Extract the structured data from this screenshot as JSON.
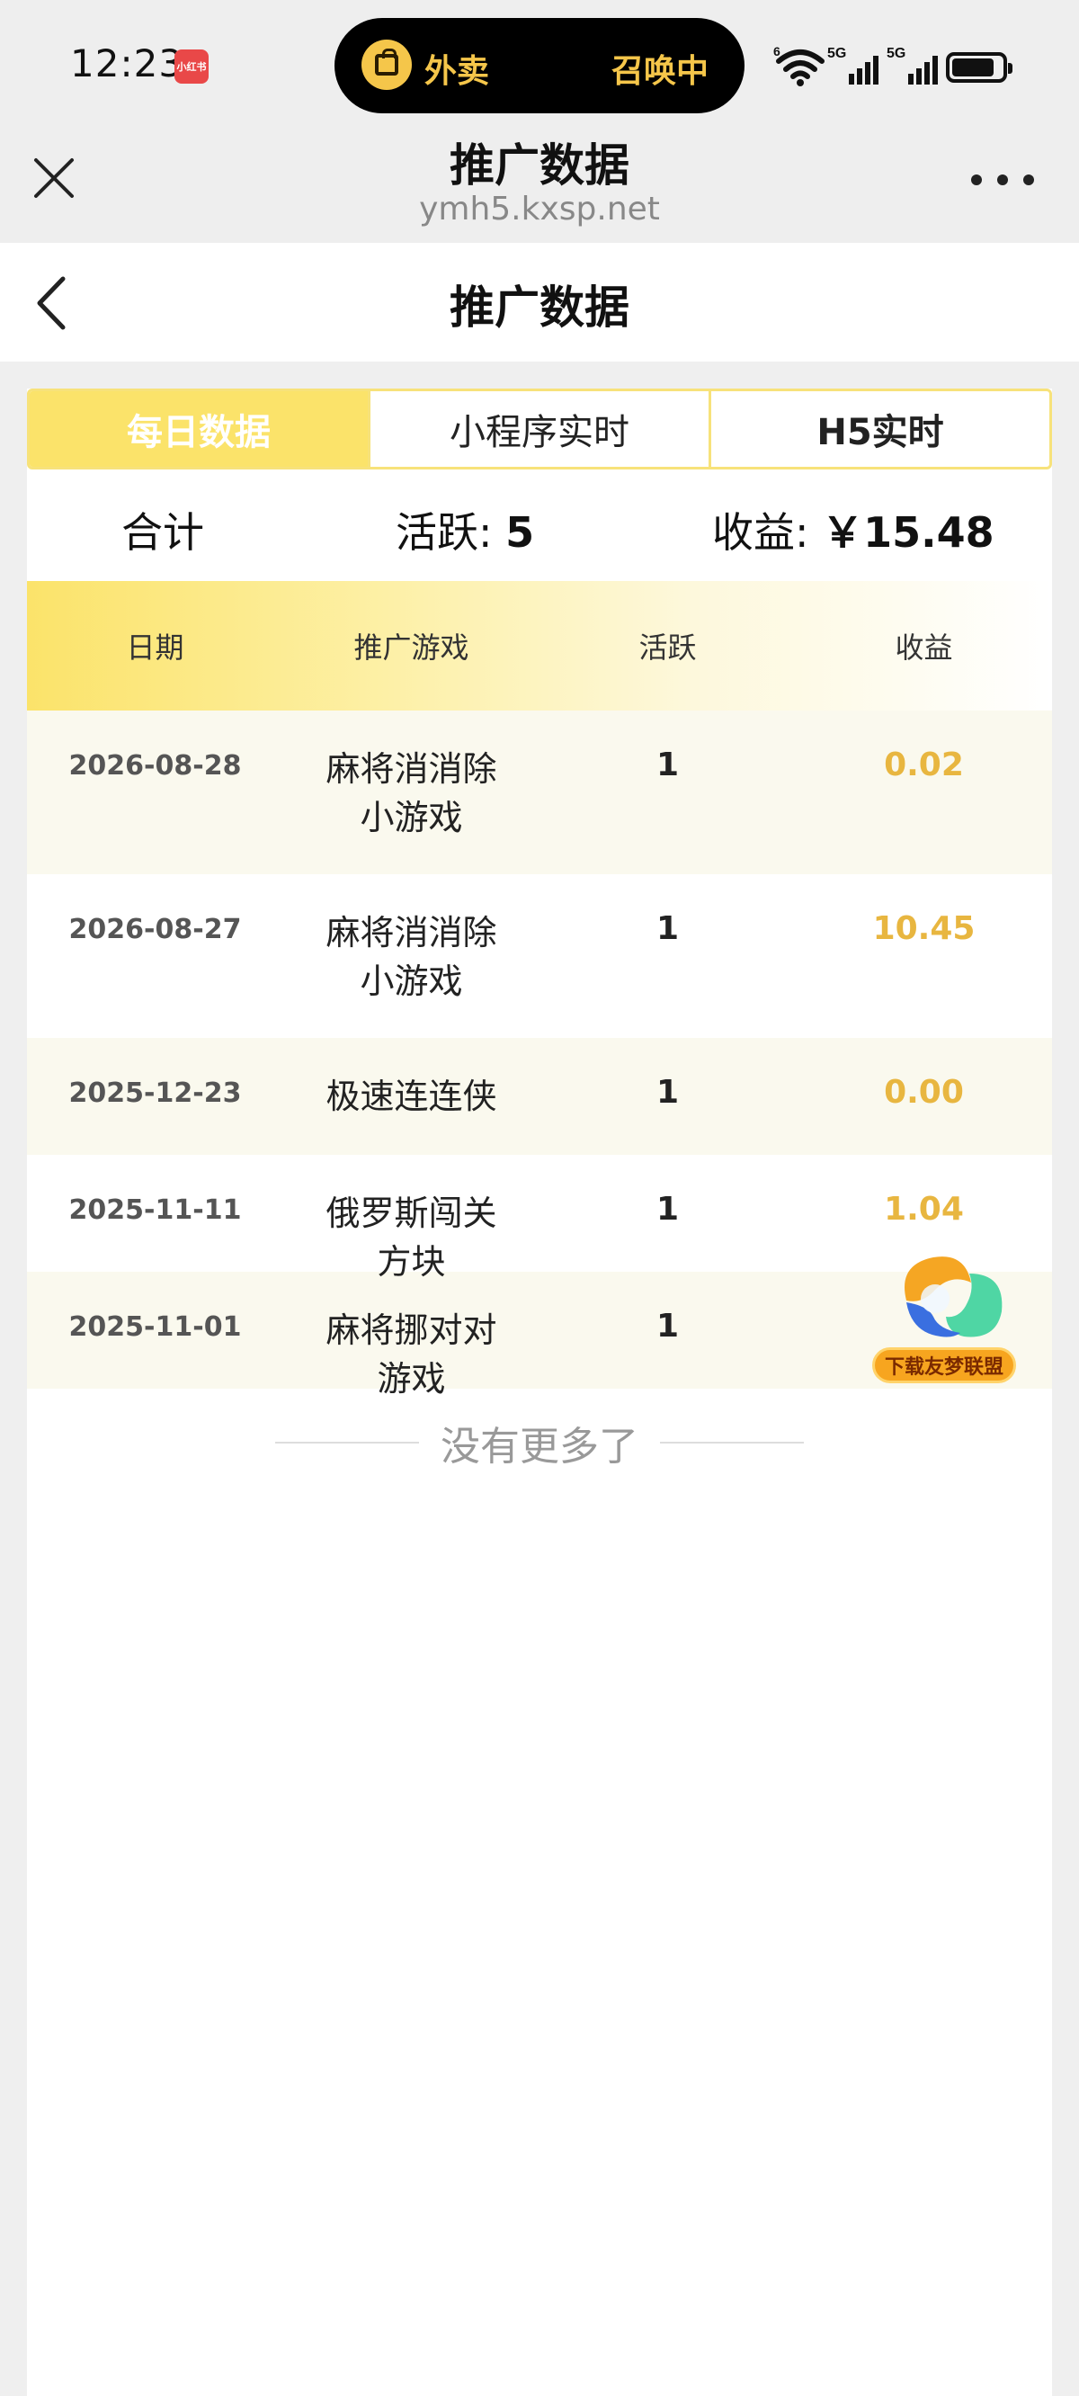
{
  "status_bar": {
    "time": "12:23",
    "app_badge": "小红书",
    "island_left": "外卖",
    "island_right": "召唤中",
    "network_1": "5G",
    "network_2": "5G",
    "wifi_badge": "6"
  },
  "browser": {
    "title": "推广数据",
    "url": "ymh5.kxsp.net"
  },
  "page": {
    "title": "推广数据"
  },
  "tabs": [
    {
      "label": "每日数据",
      "active": true
    },
    {
      "label": "小程序实时",
      "active": false
    },
    {
      "label": "H5实时",
      "active": false
    }
  ],
  "summary": {
    "label": "合计",
    "active_label": "活跃: ",
    "active_value": "5",
    "income_label": "收益: ",
    "income_value": "￥15.48"
  },
  "table": {
    "headers": [
      "日期",
      "推广游戏",
      "活跃",
      "收益"
    ],
    "rows": [
      {
        "date": "2026-08-28",
        "game": "麻将消消除小游戏",
        "active": "1",
        "income": "0.02"
      },
      {
        "date": "2026-08-27",
        "game": "麻将消消除小游戏",
        "active": "1",
        "income": "10.45"
      },
      {
        "date": "2025-12-23",
        "game": "极速连连侠",
        "active": "1",
        "income": "0.00"
      },
      {
        "date": "2025-11-11",
        "game": "俄罗斯闯关方块",
        "active": "1",
        "income": "1.04"
      },
      {
        "date": "2025-11-01",
        "game": "麻将挪对对游戏",
        "active": "1",
        "income": ""
      }
    ]
  },
  "footer": {
    "no_more": "没有更多了"
  },
  "float_badge": {
    "label": "下载友梦联盟"
  },
  "colors": {
    "accent_yellow": "#fbe36a",
    "income_gold": "#e8b640",
    "row_shade": "#faf9ee"
  }
}
